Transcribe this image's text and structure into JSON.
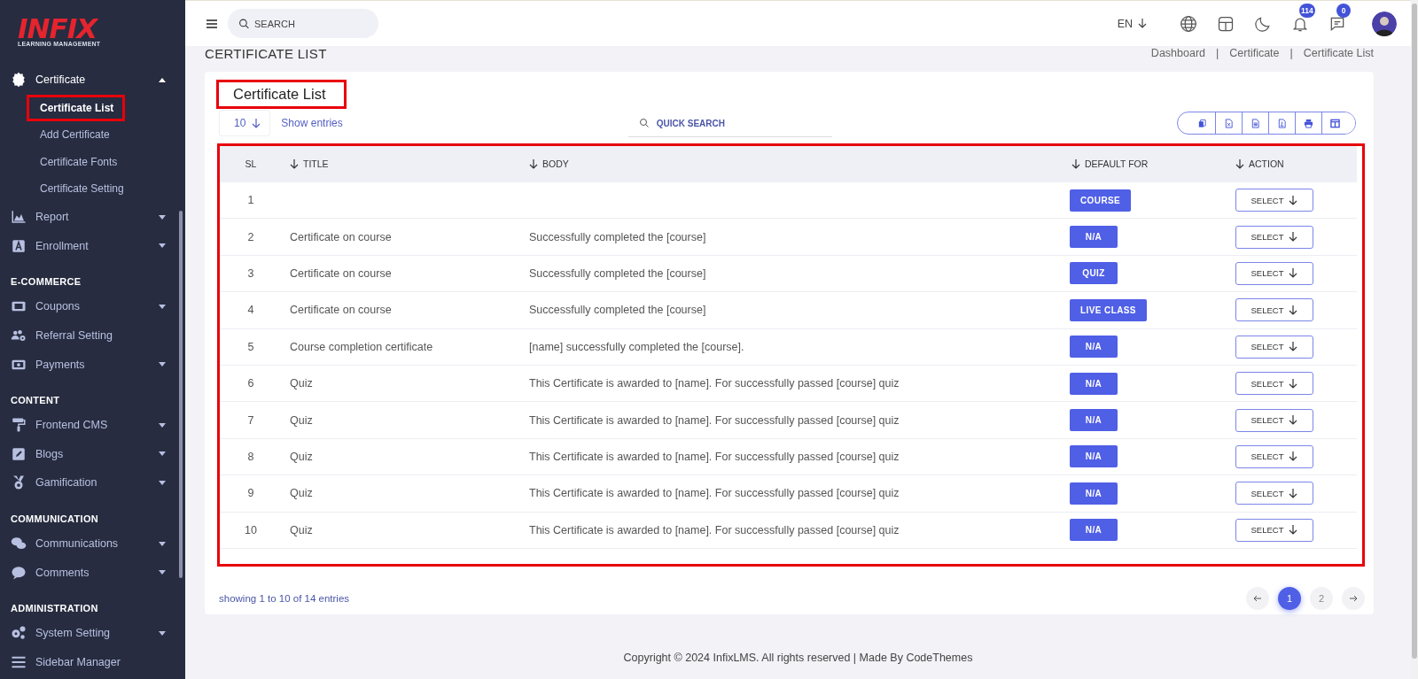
{
  "sidebar": {
    "logo": {
      "name": "INFIX",
      "tagline": "LEARNING MANAGEMENT"
    },
    "sections": [
      {
        "items": [
          {
            "label": "Certificate",
            "kind": "group",
            "expanded": true,
            "children": [
              {
                "label": "Certificate List",
                "selected": true,
                "highlighted": true
              },
              {
                "label": "Add Certificate",
                "selected": false,
                "highlighted": false
              },
              {
                "label": "Certificate Fonts",
                "selected": false,
                "highlighted": false
              },
              {
                "label": "Certificate Setting",
                "selected": false,
                "highlighted": false
              }
            ]
          },
          {
            "label": "Report",
            "kind": "group",
            "expanded": false
          },
          {
            "label": "Enrollment",
            "kind": "group",
            "expanded": false
          }
        ]
      },
      {
        "heading": "E-COMMERCE",
        "items": [
          {
            "label": "Coupons",
            "kind": "group",
            "expanded": false
          },
          {
            "label": "Referral Setting",
            "kind": "link"
          },
          {
            "label": "Payments",
            "kind": "group",
            "expanded": false
          }
        ]
      },
      {
        "heading": "CONTENT",
        "items": [
          {
            "label": "Frontend CMS",
            "kind": "group",
            "expanded": false
          },
          {
            "label": "Blogs",
            "kind": "group",
            "expanded": false
          },
          {
            "label": "Gamification",
            "kind": "group",
            "expanded": false
          }
        ]
      },
      {
        "heading": "COMMUNICATION",
        "items": [
          {
            "label": "Communications",
            "kind": "group",
            "expanded": false
          },
          {
            "label": "Comments",
            "kind": "group",
            "expanded": false
          }
        ]
      },
      {
        "heading": "ADMINISTRATION",
        "items": [
          {
            "label": "System Setting",
            "kind": "group",
            "expanded": false
          },
          {
            "label": "Sidebar Manager",
            "kind": "link"
          }
        ]
      }
    ]
  },
  "header": {
    "search": {
      "placeholder": "SEARCH"
    },
    "language": "EN",
    "notifications": "114",
    "messages": "0"
  },
  "page": {
    "title": "CERTIFICATE LIST",
    "breadcrumb": [
      "Dashboard",
      "Certificate",
      "Certificate List"
    ],
    "breadcrumb_separator": "|"
  },
  "card": {
    "title": "Certificate List",
    "highlighted": true,
    "entries": {
      "value": "10",
      "label": "Show entries"
    },
    "quick_search": {
      "placeholder": "QUICK SEARCH"
    },
    "table": {
      "highlighted": true,
      "columns": [
        {
          "label": "SL",
          "sortable": false
        },
        {
          "label": "TITLE",
          "sortable": true
        },
        {
          "label": "BODY",
          "sortable": true
        },
        {
          "label": "DEFAULT FOR",
          "sortable": true
        },
        {
          "label": "ACTION",
          "sortable": true
        }
      ],
      "rows": [
        {
          "sl": "1",
          "default_for": "COURSE",
          "action": "SELECT"
        },
        {
          "sl": "2",
          "title": "Certificate on course",
          "body": "Successfully completed the [course]",
          "default_for": "N/A",
          "action": "SELECT"
        },
        {
          "sl": "3",
          "title": "Certificate on course",
          "body": "Successfully completed the [course]",
          "default_for": "QUIZ",
          "action": "SELECT"
        },
        {
          "sl": "4",
          "title": "Certificate on course",
          "body": "Successfully completed the [course]",
          "default_for": "LIVE CLASS",
          "action": "SELECT"
        },
        {
          "sl": "5",
          "title": "Course completion certificate",
          "body": "[name] successfully completed the [course].",
          "default_for": "N/A",
          "action": "SELECT"
        },
        {
          "sl": "6",
          "title": "Quiz",
          "body": "This Certificate is awarded to [name]. For successfully passed [course] quiz",
          "default_for": "N/A",
          "action": "SELECT"
        },
        {
          "sl": "7",
          "title": "Quiz",
          "body": "This Certificate is awarded to [name]. For successfully passed [course] quiz",
          "default_for": "N/A",
          "action": "SELECT"
        },
        {
          "sl": "8",
          "title": "Quiz",
          "body": "This Certificate is awarded to [name]. For successfully passed [course] quiz",
          "default_for": "N/A",
          "action": "SELECT"
        },
        {
          "sl": "9",
          "title": "Quiz",
          "body": "This Certificate is awarded to [name]. For successfully passed [course] quiz",
          "default_for": "N/A",
          "action": "SELECT"
        },
        {
          "sl": "10",
          "title": "Quiz",
          "body": "This Certificate is awarded to [name]. For successfully passed [course] quiz",
          "default_for": "N/A",
          "action": "SELECT"
        }
      ]
    },
    "summary": "showing 1 to 10 of 14 entries",
    "pages": [
      {
        "label": "1",
        "selected": true
      },
      {
        "label": "2",
        "selected": false
      }
    ]
  },
  "footer": "Copyright © 2024 InfixLMS. All rights reserved | Made By CodeThemes"
}
